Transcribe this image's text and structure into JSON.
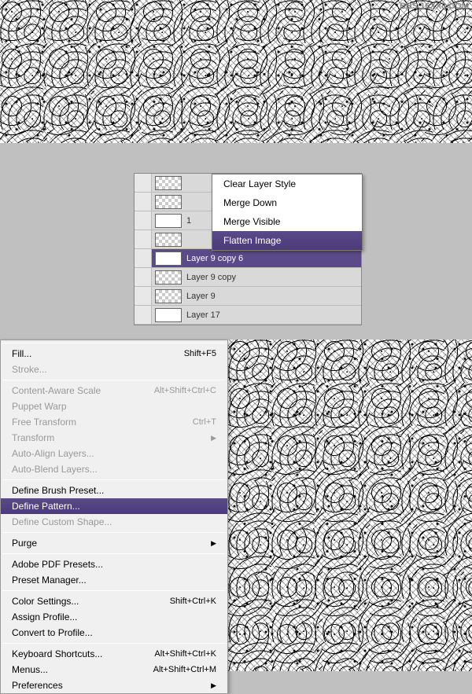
{
  "watermark": "BBS.16XX8.COM",
  "layers": {
    "items": [
      {
        "label": ""
      },
      {
        "label": ""
      },
      {
        "label": "1"
      },
      {
        "label": ""
      },
      {
        "label": "Layer 9 copy 6"
      },
      {
        "label": "Layer 9 copy"
      },
      {
        "label": "Layer 9"
      },
      {
        "label": "Layer 17"
      }
    ]
  },
  "contextMenu": {
    "clear": "Clear Layer Style",
    "mergeDown": "Merge Down",
    "mergeVisible": "Merge Visible",
    "flatten": "Flatten Image"
  },
  "editMenu": {
    "fill": "Fill...",
    "fillShort": "Shift+F5",
    "stroke": "Stroke...",
    "contentAware": "Content-Aware Scale",
    "contentAwareShort": "Alt+Shift+Ctrl+C",
    "puppet": "Puppet Warp",
    "freeTransform": "Free Transform",
    "freeTransformShort": "Ctrl+T",
    "transform": "Transform",
    "autoAlign": "Auto-Align Layers...",
    "autoBlend": "Auto-Blend Layers...",
    "defineBrush": "Define Brush Preset...",
    "definePattern": "Define Pattern...",
    "defineShape": "Define Custom Shape...",
    "purge": "Purge",
    "pdfPresets": "Adobe PDF Presets...",
    "presetManager": "Preset Manager...",
    "colorSettings": "Color Settings...",
    "colorSettingsShort": "Shift+Ctrl+K",
    "assignProfile": "Assign Profile...",
    "convertProfile": "Convert to Profile...",
    "keyboard": "Keyboard Shortcuts...",
    "keyboardShort": "Alt+Shift+Ctrl+K",
    "menus": "Menus...",
    "menusShort": "Alt+Shift+Ctrl+M",
    "preferences": "Preferences"
  }
}
